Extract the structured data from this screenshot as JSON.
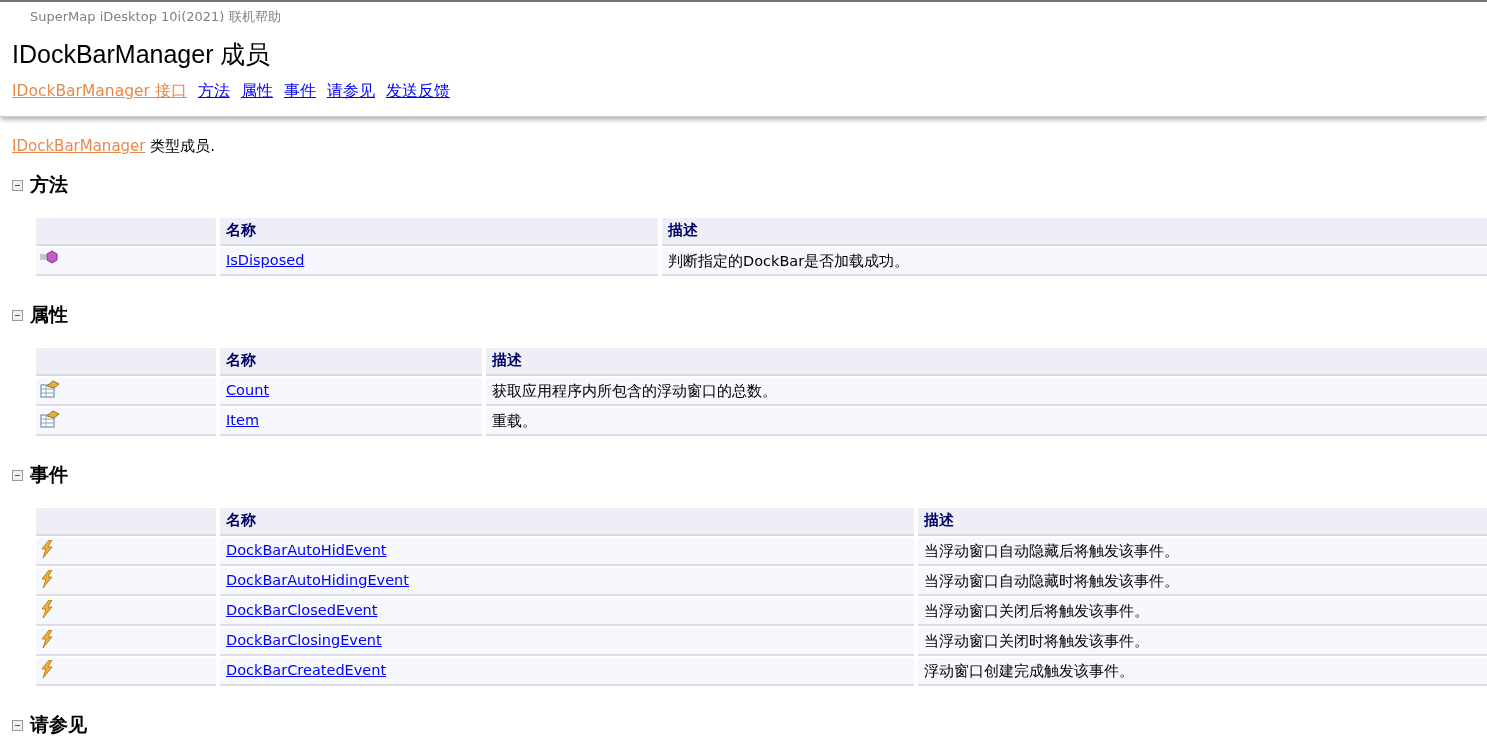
{
  "header": {
    "product": "SuperMap iDesktop 10i(2021) 联机帮助",
    "title": "IDockBarManager 成员",
    "links": [
      {
        "label": "IDockBarManager 接口",
        "kind": "visited"
      },
      {
        "label": "方法",
        "kind": "link"
      },
      {
        "label": "属性",
        "kind": "link"
      },
      {
        "label": "事件",
        "kind": "link"
      },
      {
        "label": "请参见",
        "kind": "link"
      },
      {
        "label": "发送反馈",
        "kind": "link"
      }
    ]
  },
  "intro": {
    "link": "IDockBarManager",
    "text": "类型成员."
  },
  "sections": [
    {
      "title": "方法",
      "expanded": true,
      "columns": [
        "名称",
        "描述"
      ],
      "rows": [
        {
          "kind": "method",
          "name": "IsDisposed",
          "description": "判断指定的DockBar是否加载成功。"
        }
      ]
    },
    {
      "title": "属性",
      "expanded": true,
      "columns": [
        "名称",
        "描述"
      ],
      "rows": [
        {
          "kind": "property",
          "name": "Count",
          "description": "获取应用程序内所包含的浮动窗口的总数。"
        },
        {
          "kind": "property",
          "name": "Item",
          "description": "重载。"
        }
      ]
    },
    {
      "title": "事件",
      "expanded": true,
      "columns": [
        "名称",
        "描述"
      ],
      "rows": [
        {
          "kind": "event",
          "name": "DockBarAutoHidEvent",
          "description": "当浮动窗口自动隐藏后将触发该事件。"
        },
        {
          "kind": "event",
          "name": "DockBarAutoHidingEvent",
          "description": "当浮动窗口自动隐藏时将触发该事件。"
        },
        {
          "kind": "event",
          "name": "DockBarClosedEvent",
          "description": "当浮动窗口关闭后将触发该事件。"
        },
        {
          "kind": "event",
          "name": "DockBarClosingEvent",
          "description": "当浮动窗口关闭时将触发该事件。"
        },
        {
          "kind": "event",
          "name": "DockBarCreatedEvent",
          "description": "浮动窗口创建完成触发该事件。"
        }
      ]
    },
    {
      "title": "请参见",
      "expanded": true
    }
  ]
}
